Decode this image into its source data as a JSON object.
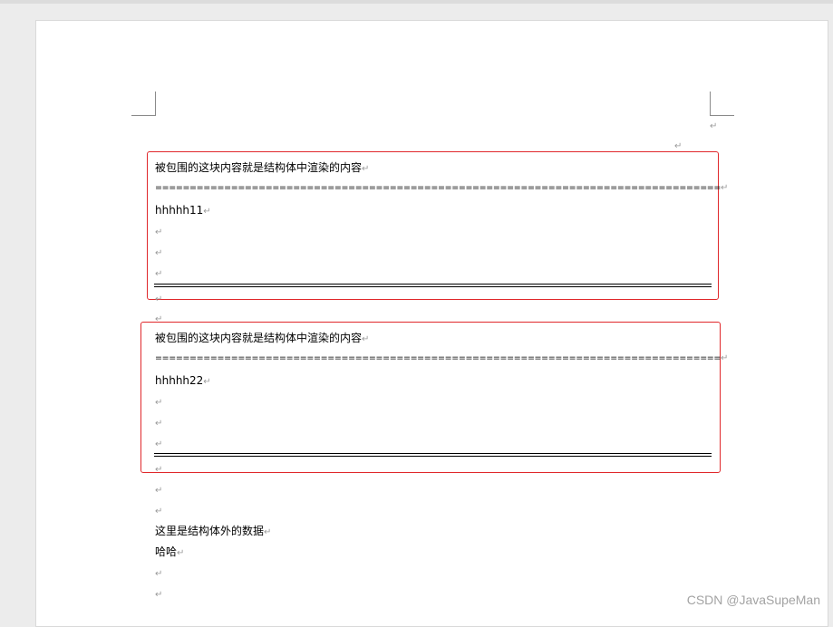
{
  "paragraph_mark": "↵",
  "block1": {
    "heading": "被包围的这块内容就是结构体中渲染的内容",
    "separator": "==================================================================================",
    "value": "hhhhh11"
  },
  "block2": {
    "heading": "被包围的这块内容就是结构体中渲染的内容",
    "separator": "==================================================================================",
    "value": "hhhhh22"
  },
  "outside": {
    "line1": "这里是结构体外的数据",
    "line2": "哈哈"
  },
  "watermark": "CSDN @JavaSupeMan",
  "colors": {
    "highlight": "#e0282b",
    "paragraph_mark": "#9b9b9b"
  }
}
